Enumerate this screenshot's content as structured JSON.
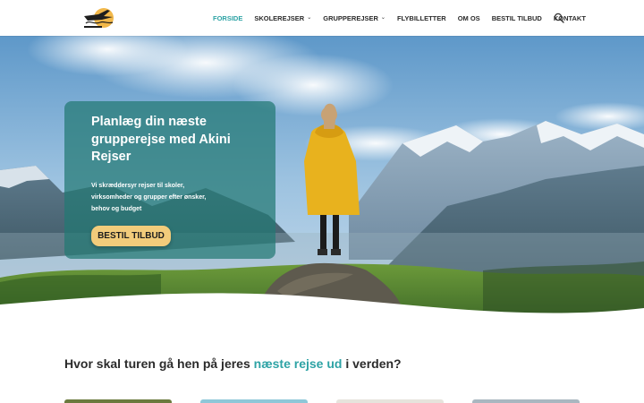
{
  "brand": {
    "name": "Akini Rejser"
  },
  "nav": {
    "items": [
      {
        "label": "FORSIDE",
        "active": true,
        "dropdown": false
      },
      {
        "label": "SKOLEREJSER",
        "active": false,
        "dropdown": true
      },
      {
        "label": "GRUPPEREJSER",
        "active": false,
        "dropdown": true
      },
      {
        "label": "FLYBILLETTER",
        "active": false,
        "dropdown": false
      },
      {
        "label": "OM OS",
        "active": false,
        "dropdown": false
      },
      {
        "label": "BESTIL TILBUD",
        "active": false,
        "dropdown": false
      },
      {
        "label": "KONTAKT",
        "active": false,
        "dropdown": false
      }
    ],
    "search_icon": "search-icon",
    "chevron_icon": "chevron-down-icon"
  },
  "hero": {
    "title": "Planlæg din næste grupperejse med Akini Rejser",
    "text": "Vi skræddersyr rejser til skoler, virksomheder og grupper efter ønsker, behov og budget",
    "button": "BESTIL TILBUD"
  },
  "section": {
    "heading_before": "Hvor skal turen gå hen på jeres ",
    "heading_highlight": "næste rejse ud",
    "heading_after": " i verden?"
  },
  "colors": {
    "accent": "#2ea3a5",
    "button": "#f2cc7b",
    "card": "#237873",
    "text": "#2b2b2b"
  }
}
